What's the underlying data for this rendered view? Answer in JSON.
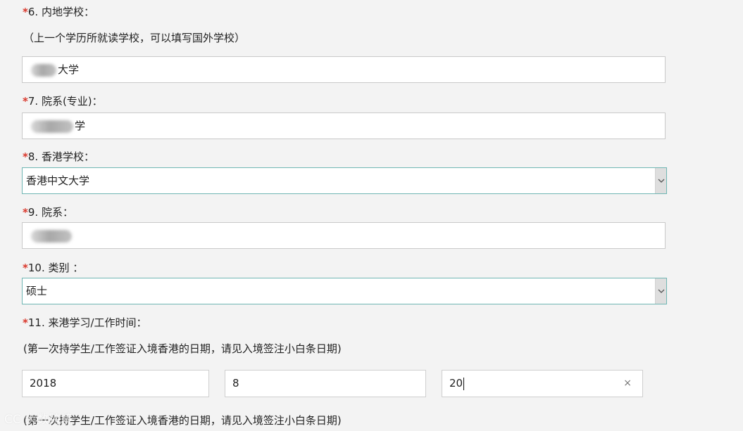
{
  "form": {
    "q6": {
      "star": "*",
      "label": "6. 内地学校：",
      "hint": "（上一个学历所就读学校，可以填写国外学校）",
      "value_suffix": "大学"
    },
    "q7": {
      "star": "*",
      "label": "7. 院系(专业)：",
      "value_suffix": "学"
    },
    "q8": {
      "star": "*",
      "label": "8. 香港学校：",
      "selected": "香港中文大学"
    },
    "q9": {
      "star": "*",
      "label": "9. 院系："
    },
    "q10": {
      "star": "*",
      "label": "10. 类别 ：",
      "selected": "硕士"
    },
    "q11": {
      "star": "*",
      "label": "11. 来港学习/工作时间：",
      "hint": "(第一次持学生/工作签证入境香港的日期，请见入境签注小白条日期)",
      "year": "2018",
      "month": "8",
      "day": "20",
      "clear_icon": "×"
    },
    "q12": {
      "hint": "(第一次持学生/工作签证入境香港的日期，请见入境签注小白条日期)"
    }
  },
  "watermark": {
    "text": "CC 大数跨境"
  },
  "colors": {
    "required_star": "#d9372b",
    "select_border": "#6fb6b3",
    "page_bg": "#f3f3f3"
  },
  "icons": {
    "select_arrow": "chevron-down-icon",
    "clear": "clear-icon"
  }
}
